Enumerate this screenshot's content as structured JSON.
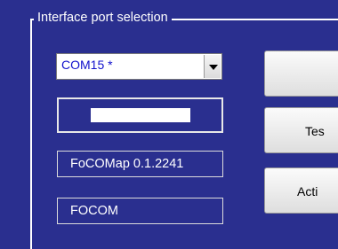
{
  "group": {
    "title": "Interface port selection"
  },
  "port_combo": {
    "value": "COM15 *"
  },
  "version_label": "FoCOMap 0.1.2241",
  "name_label": "FOCOM",
  "buttons": {
    "test_label": "Tes",
    "activate_label": "Acti"
  }
}
